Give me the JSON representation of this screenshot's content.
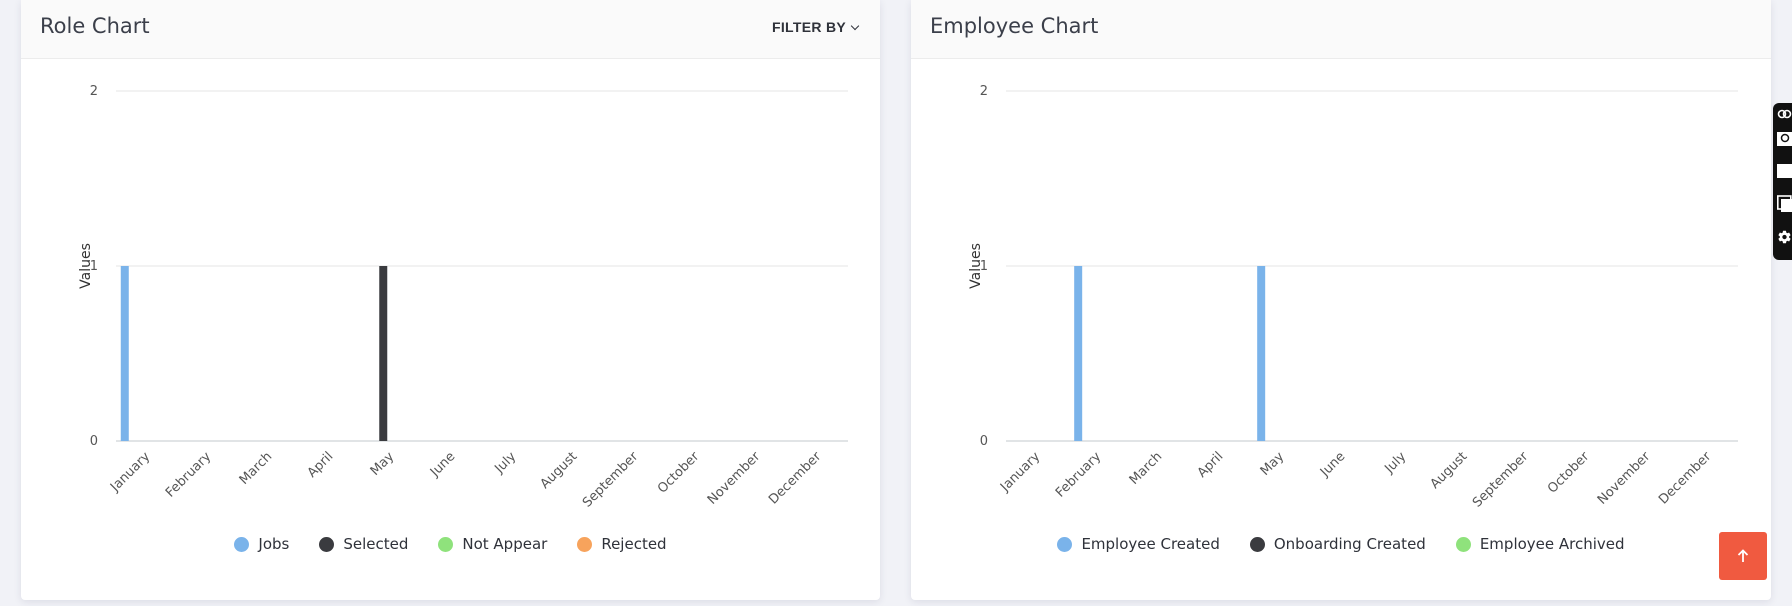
{
  "role_chart": {
    "title": "Role Chart",
    "filter_label": "FILTER BY",
    "chart_data": {
      "type": "bar",
      "categories": [
        "January",
        "February",
        "March",
        "April",
        "May",
        "June",
        "July",
        "August",
        "September",
        "October",
        "November",
        "December"
      ],
      "series": [
        {
          "name": "Jobs",
          "color": "#7ab3ea",
          "values": [
            1,
            0,
            0,
            0,
            0,
            0,
            0,
            0,
            0,
            0,
            0,
            0
          ]
        },
        {
          "name": "Selected",
          "color": "#3a3b3f",
          "values": [
            0,
            0,
            0,
            0,
            1,
            0,
            0,
            0,
            0,
            0,
            0,
            0
          ]
        },
        {
          "name": "Not Appear",
          "color": "#8fe27c",
          "values": [
            0,
            0,
            0,
            0,
            0,
            0,
            0,
            0,
            0,
            0,
            0,
            0
          ]
        },
        {
          "name": "Rejected",
          "color": "#f7a35c",
          "values": [
            0,
            0,
            0,
            0,
            0,
            0,
            0,
            0,
            0,
            0,
            0,
            0
          ]
        }
      ],
      "ylabel": "Values",
      "yticks": [
        0,
        1,
        2
      ],
      "ylim": [
        0,
        2
      ],
      "grid": true,
      "legend": "bottom-center"
    }
  },
  "employee_chart": {
    "title": "Employee Chart",
    "chart_data": {
      "type": "bar",
      "categories": [
        "January",
        "February",
        "March",
        "April",
        "May",
        "June",
        "July",
        "August",
        "September",
        "October",
        "November",
        "December"
      ],
      "series": [
        {
          "name": "Employee Created",
          "color": "#7ab3ea",
          "values": [
            0,
            1,
            0,
            0,
            1,
            0,
            0,
            0,
            0,
            0,
            0,
            0
          ]
        },
        {
          "name": "Onboarding Created",
          "color": "#3a3b3f",
          "values": [
            0,
            0,
            0,
            0,
            0,
            0,
            0,
            0,
            0,
            0,
            0,
            0
          ]
        },
        {
          "name": "Employee Archived",
          "color": "#8fe27c",
          "values": [
            0,
            0,
            0,
            0,
            0,
            0,
            0,
            0,
            0,
            0,
            0,
            0
          ]
        }
      ],
      "ylabel": "Values",
      "yticks": [
        0,
        1,
        2
      ],
      "ylim": [
        0,
        2
      ],
      "grid": true,
      "legend": "bottom-center"
    }
  },
  "toolbar": {
    "icons": [
      "link-icon",
      "search-icon",
      "square-icon",
      "window-icon",
      "gear-icon"
    ]
  },
  "scroll_top": {
    "icon": "arrow-up-icon",
    "color": "#f05a40"
  }
}
